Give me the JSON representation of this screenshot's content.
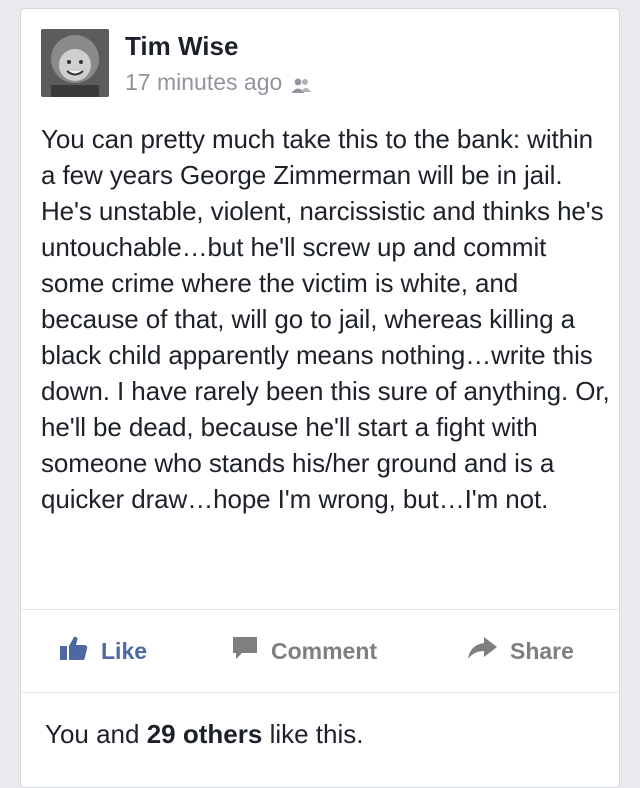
{
  "post": {
    "author": "Tim Wise",
    "timestamp": "17 minutes ago",
    "audience_icon": "friends-icon",
    "text": "You can pretty much take this to the bank: within a few years George Zimmerman will be in jail. He's unstable, violent, narcissistic and thinks he's untouchable…but he'll screw up and commit some crime where the victim is white, and because of that, will go to jail, whereas killing a black child apparently means nothing…write this down. I have rarely been this sure of anything. Or, he'll be dead, because he'll start a fight with someone who stands his/her ground and is a quicker draw…hope I'm wrong, but…I'm not."
  },
  "actions": {
    "like_label": "Like",
    "comment_label": "Comment",
    "share_label": "Share"
  },
  "likes_summary": {
    "prefix": "You and",
    "count": "29 others",
    "suffix": "like this."
  },
  "colors": {
    "like_blue": "#4e69a2",
    "muted_gray": "#90949c",
    "text": "#1d2129"
  }
}
